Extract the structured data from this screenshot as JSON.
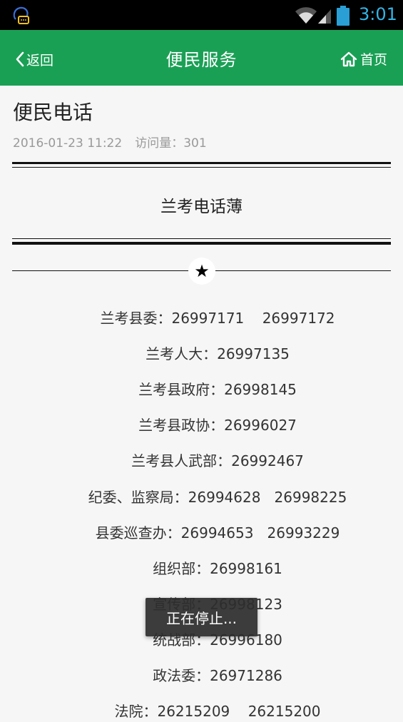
{
  "status_bar": {
    "time": "3:01",
    "icons": [
      "notification-chat-icon",
      "wifi-icon",
      "signal-icon",
      "battery-icon"
    ]
  },
  "header": {
    "back_label": "返回",
    "title": "便民服务",
    "home_label": "首页"
  },
  "article": {
    "title": "便民电话",
    "date": "2016-01-23 11:22",
    "views": "访问量：301",
    "section_title": "兰考电话薄"
  },
  "phone_entries": [
    "兰考县委：26997171    26997172",
    "兰考人大：26997135",
    "兰考县政府：26998145",
    "兰考县政协：26996027",
    "兰考县人武部：26992467",
    "纪委、监察局：26994628   26998225",
    "县委巡查办：26994653   26993229",
    "组织部：26998161",
    "宣传部：26998123",
    "统战部：26996180",
    "政法委：26971286",
    "法院：26215209    26215200"
  ],
  "toast": {
    "text": "正在停止..."
  },
  "colors": {
    "header_bg": "#1aa055",
    "status_clock": "#33b5e5"
  }
}
